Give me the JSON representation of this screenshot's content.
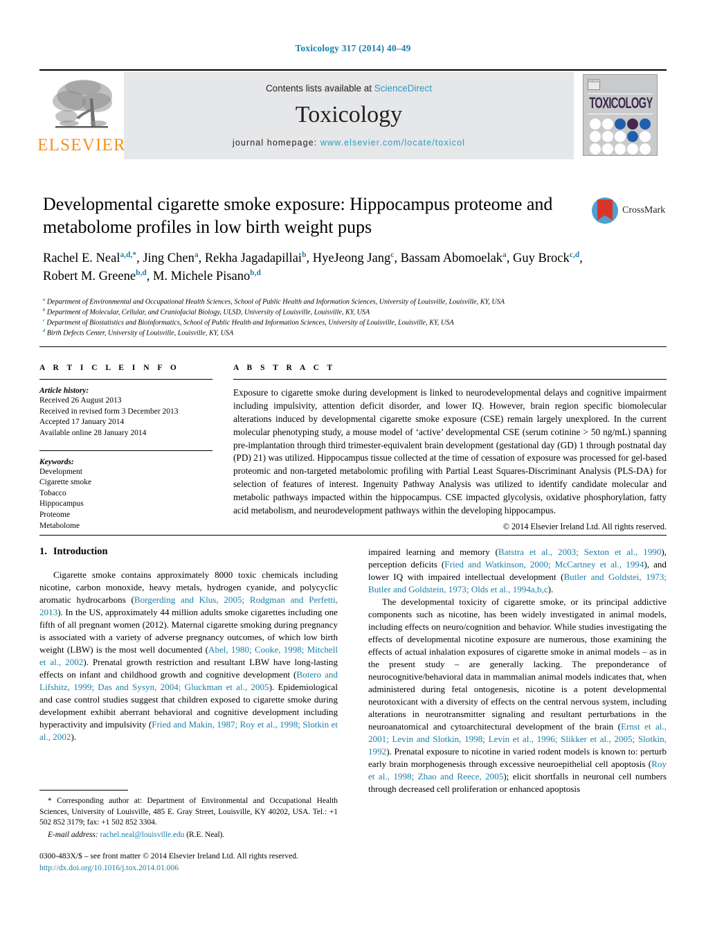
{
  "running_head": "Toxicology 317 (2014) 40–49",
  "masthead": {
    "contents_prefix": "Contents lists available at ",
    "sciencedirect": "ScienceDirect",
    "journal_title": "Toxicology",
    "homepage_prefix": "journal homepage:",
    "homepage_url": "www.elsevier.com/locate/toxicol",
    "publisher": "ELSEVIER",
    "cover_title": "TOXICOLOGY",
    "cover_corner_text": "TOXICOLOGY"
  },
  "crossmark": {
    "label": "CrossMark"
  },
  "article": {
    "title": "Developmental cigarette smoke exposure: Hippocampus proteome and metabolome profiles in low birth weight pups",
    "authors_line_1": "Rachel E. Neal",
    "authors": [
      {
        "name": "Rachel E. Neal",
        "sup": "a,d,*"
      },
      {
        "name": "Jing Chen",
        "sup": "a"
      },
      {
        "name": "Rekha Jagadapillai",
        "sup": "b"
      },
      {
        "name": "HyeJeong Jang",
        "sup": "c"
      },
      {
        "name": "Bassam Abomoelak",
        "sup": "a"
      },
      {
        "name": "Guy Brock",
        "sup": "c,d"
      },
      {
        "name": "Robert M. Greene",
        "sup": "b,d"
      },
      {
        "name": "M. Michele Pisano",
        "sup": "b,d"
      }
    ],
    "affiliations": [
      {
        "sup": "a",
        "text": "Department of Environmental and Occupational Health Sciences, School of Public Health and Information Sciences, University of Louisville, Louisville, KY, USA"
      },
      {
        "sup": "b",
        "text": "Department of Molecular, Cellular, and Craniofacial Biology, ULSD, University of Louisville, Louisville, KY, USA"
      },
      {
        "sup": "c",
        "text": "Department of Biostatistics and Bioinformatics, School of Public Health and Information Sciences, University of Louisville, Louisville, KY, USA"
      },
      {
        "sup": "d",
        "text": "Birth Defects Center, University of Louisville, Louisville, KY, USA"
      }
    ]
  },
  "article_info": {
    "heading": "A R T I C L E   I N F O",
    "history_label": "Article history:",
    "history": [
      "Received 26 August 2013",
      "Received in revised form 3 December 2013",
      "Accepted 17 January 2014",
      "Available online 28 January 2014"
    ],
    "keywords_label": "Keywords:",
    "keywords": [
      "Development",
      "Cigarette smoke",
      "Tobacco",
      "Hippocampus",
      "Proteome",
      "Metabolome"
    ]
  },
  "abstract": {
    "heading": "A B S T R A C T",
    "text": "Exposure to cigarette smoke during development is linked to neurodevelopmental delays and cognitive impairment including impulsivity, attention deficit disorder, and lower IQ. However, brain region specific biomolecular alterations induced by developmental cigarette smoke exposure (CSE) remain largely unexplored. In the current molecular phenotyping study, a mouse model of ‘active’ developmental CSE (serum cotinine > 50 ng/mL) spanning pre-implantation through third trimester-equivalent brain development (gestational day (GD) 1 through postnatal day (PD) 21) was utilized. Hippocampus tissue collected at the time of cessation of exposure was processed for gel-based proteomic and non-targeted metabolomic profiling with Partial Least Squares-Discriminant Analysis (PLS-DA) for selection of features of interest. Ingenuity Pathway Analysis was utilized to identify candidate molecular and metabolic pathways impacted within the hippocampus. CSE impacted glycolysis, oxidative phosphorylation, fatty acid metabolism, and neurodevelopment pathways within the developing hippocampus.",
    "copyright": "© 2014 Elsevier Ireland Ltd. All rights reserved."
  },
  "body": {
    "section_number": "1.",
    "section_title": "Introduction",
    "left_para_1": {
      "p1": "Cigarette smoke contains approximately 8000 toxic chemicals including nicotine, carbon monoxide, heavy metals, hydrogen cyanide, and polycyclic aromatic hydrocarbons (",
      "r1": "Borgerding and Klus, 2005; Rodgman and Perfetti, 2013",
      "p2": "). In the US, approximately 44 million adults smoke cigarettes including one fifth of all pregnant women (2012). Maternal cigarette smoking during pregnancy is associated with a variety of adverse pregnancy outcomes, of which low birth weight (LBW) is the most well documented (",
      "r2": "Abel, 1980; Cooke, 1998; Mitchell et al., 2002",
      "p3": "). Prenatal growth restriction and resultant LBW have long-lasting effects on infant and childhood growth and cognitive development (",
      "r3": "Botero and Lifshitz, 1999; Das and Sysyn, 2004; Gluckman et al., 2005",
      "p4": "). Epidemiological and case control studies suggest that children exposed to cigarette smoke during development exhibit aberrant behavioral and cognitive development including hyperactivity and impulsivity (",
      "r4": "Fried and Makin, 1987; Roy et al., 1998; Slotkin et al., 2002",
      "p5": ")."
    },
    "right_para_cont": {
      "p1": "impaired learning and memory (",
      "r1": "Batstra et al., 2003; Sexton et al., 1990",
      "p2": "), perception deficits (",
      "r2": "Fried and Watkinson, 2000; McCartney et al., 1994",
      "p3": "), and lower IQ with impaired intellectual development (",
      "r3": "Butler and Goldstei, 1973; Butler and Goldstein, 1973; Olds et al., 1994a,b,c",
      "p4": ")."
    },
    "right_para_2": {
      "p1": "The developmental toxicity of cigarette smoke, or its principal addictive components such as nicotine, has been widely investigated in animal models, including effects on neuro/cognition and behavior. While studies investigating the effects of developmental nicotine exposure are numerous, those examining the effects of actual inhalation exposures of cigarette smoke in animal models – as in the present study – are generally lacking. The preponderance of neurocognitive/behavioral data in mammalian animal models indicates that, when administered during fetal ontogenesis, nicotine is a potent developmental neurotoxicant with a diversity of effects on the central nervous system, including alterations in neurotransmitter signaling and resultant perturbations in the neuroanatomical and cytoarchitectural development of the brain (",
      "r1": "Ernst et al., 2001; Levin and Slotkin, 1998; Levin et al., 1996; Slikker et al., 2005; Slotkin, 1992",
      "p2": "). Prenatal exposure to nicotine in varied rodent models is known to: perturb early brain morphogenesis through excessive neuroepithelial cell apoptosis (",
      "r2": "Roy et al., 1998; Zhao and Reece, 2005",
      "p3": "); elicit shortfalls in neuronal cell numbers through decreased cell proliferation or enhanced apoptosis"
    }
  },
  "footnotes": {
    "corresponding": "Corresponding author at: Department of Environmental and Occupational Health Sciences, University of Louisville, 485 E. Gray Street, Louisville, KY 40202, USA. Tel.: +1 502 852 3179; fax: +1 502 852 3304.",
    "email_label": "E-mail address:",
    "email": "rachel.neal@louisville.edu",
    "email_owner": "(R.E. Neal).",
    "issn_line": "0300-483X/$ – see front matter © 2014 Elsevier Ireland Ltd. All rights reserved.",
    "doi": "http://dx.doi.org/10.1016/j.tox.2014.01.006"
  },
  "colors": {
    "link_blue": "#1a7fa8",
    "sciencedirect_blue": "#2b9bc9",
    "elsevier_orange": "#F7901E",
    "cover_gray": "#c9cacc",
    "band_gray": "#e6e7e8",
    "cover_dot_blue": "#1f5fae",
    "cover_dot_purple": "#45294f",
    "crossmark_blue": "#4f9fd0",
    "crossmark_red": "#d8352a"
  }
}
